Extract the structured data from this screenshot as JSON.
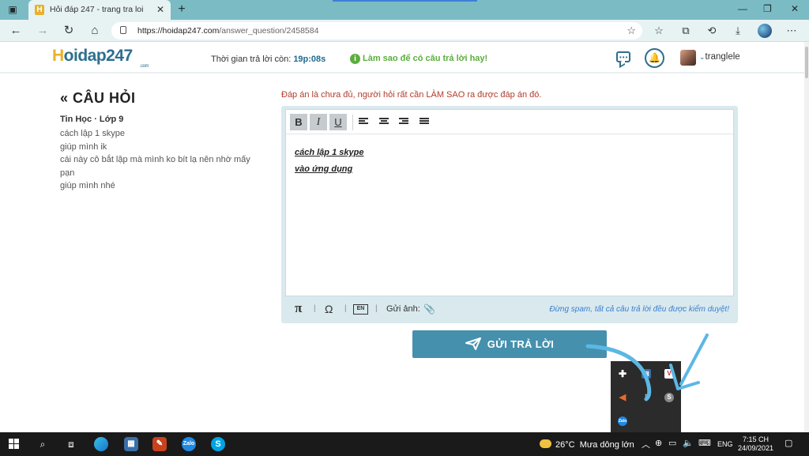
{
  "browser": {
    "tab_title": "Hỏi đáp 247 - trang tra loi",
    "url_host": "https://hoidap247.com",
    "url_path": "/answer_question/2458584"
  },
  "site": {
    "logo_main": "oidap247",
    "logo_h": "H",
    "logo_suffix": ".com",
    "timer_label": "Thời gian trả lời còn:",
    "timer_value": "19p:08s",
    "tip_text": "Làm sao để có câu trả lời hay!",
    "username": "tranglele"
  },
  "question": {
    "heading": "CÂU HỎI",
    "meta": "Tin Học · Lớp 9",
    "lines": [
      "cách lập 1 skype",
      "giúp mình ik",
      "cái này cô bắt lập mà mình ko bít lạ nên nhờ mấy pạn",
      "giúp mình nhé"
    ]
  },
  "answer": {
    "warning": "Đáp án là chưa đủ, người hỏi rất cần LÀM SAO ra được đáp án đó.",
    "content_lines": [
      "cách lập 1 skype",
      "vào ứng dụng "
    ],
    "upload_label": "Gửi ảnh:",
    "spam_note": "Đừng spam, tất cả câu trả lời đều được kiểm duyệt!",
    "submit_label": "GỬI TRẢ LỜI",
    "en_badge": "EN"
  },
  "taskbar": {
    "weather_temp": "26°C",
    "weather_text": "Mưa dông lớn",
    "lang": "ENG",
    "time": "7:15 CH",
    "date": "24/09/2021",
    "zalo_label": "Zalo"
  },
  "colors": {
    "brand": "#2d6f8e",
    "accent_yellow": "#e8b12c",
    "tip_green": "#5bae3d",
    "warn_red": "#b23b2b",
    "submit_bg": "#4590ad",
    "tabbar_bg": "#7bbbc4",
    "annotation": "#5bb7e5"
  }
}
